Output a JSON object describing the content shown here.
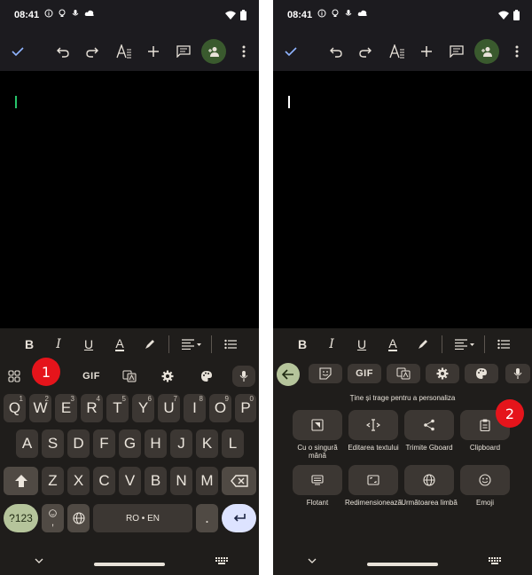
{
  "status": {
    "time": "08:41"
  },
  "keyboard": {
    "rows": [
      [
        {
          "label": "Q",
          "hint": "1"
        },
        {
          "label": "W",
          "hint": "2"
        },
        {
          "label": "E",
          "hint": "3"
        },
        {
          "label": "R",
          "hint": "4"
        },
        {
          "label": "T",
          "hint": "5"
        },
        {
          "label": "Y",
          "hint": "6"
        },
        {
          "label": "U",
          "hint": "7"
        },
        {
          "label": "I",
          "hint": "8"
        },
        {
          "label": "O",
          "hint": "9"
        },
        {
          "label": "P",
          "hint": "0"
        }
      ],
      [
        {
          "label": "A"
        },
        {
          "label": "S"
        },
        {
          "label": "D"
        },
        {
          "label": "F"
        },
        {
          "label": "G"
        },
        {
          "label": "H"
        },
        {
          "label": "J"
        },
        {
          "label": "K"
        },
        {
          "label": "L"
        }
      ],
      [
        {
          "label": "Z"
        },
        {
          "label": "X"
        },
        {
          "label": "C"
        },
        {
          "label": "V"
        },
        {
          "label": "B"
        },
        {
          "label": "N"
        },
        {
          "label": "M"
        }
      ]
    ],
    "symbols_label": "?123",
    "emoji_comma": ",",
    "space_label": "RO • EN",
    "period_label": ".",
    "gif_label": "GIF"
  },
  "menu": {
    "hint": "Ține și trage pentru a personaliza",
    "tiles": [
      {
        "label": "Cu o singură mână",
        "icon": "one-hand-icon"
      },
      {
        "label": "Editarea textului",
        "icon": "text-edit-icon"
      },
      {
        "label": "Trimite Gboard",
        "icon": "share-icon"
      },
      {
        "label": "Clipboard",
        "icon": "clipboard-icon"
      },
      {
        "label": "Flotant",
        "icon": "floating-keyboard-icon"
      },
      {
        "label": "Redimensionează",
        "icon": "resize-icon"
      },
      {
        "label": "Următoarea limbă",
        "icon": "globe-icon"
      },
      {
        "label": "Emoji",
        "icon": "emoji-icon"
      }
    ]
  },
  "badges": {
    "first": "1",
    "second": "2"
  },
  "colors": {
    "cursor_left": "#27c46a",
    "cursor_right": "#ffffff",
    "badge": "#e5141b",
    "share_button": "#3a5a2e",
    "accent_green": "#b5c49b"
  }
}
